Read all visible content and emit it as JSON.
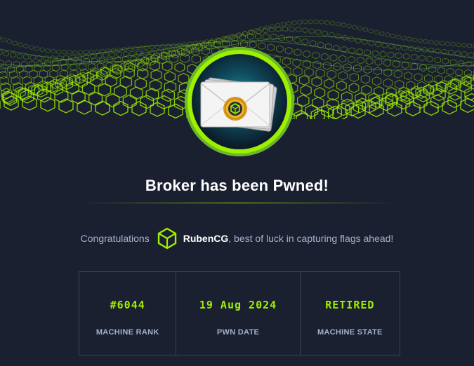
{
  "machine": {
    "icon": "envelope-icon",
    "title": "Broker has been Pwned!"
  },
  "congrats": {
    "prefix": "Congratulations",
    "user_icon": "cube-icon",
    "username": "RubenCG",
    "suffix": ", best of luck in capturing flags ahead!"
  },
  "stats": [
    {
      "value": "#6044",
      "label": "MACHINE RANK"
    },
    {
      "value": "19 Aug 2024",
      "label": "PWN DATE"
    },
    {
      "value": "RETIRED",
      "label": "MACHINE STATE"
    }
  ],
  "colors": {
    "background": "#1a2030",
    "accent": "#9fef00",
    "muted_text": "#a4b1cd",
    "border": "#3a4558"
  }
}
